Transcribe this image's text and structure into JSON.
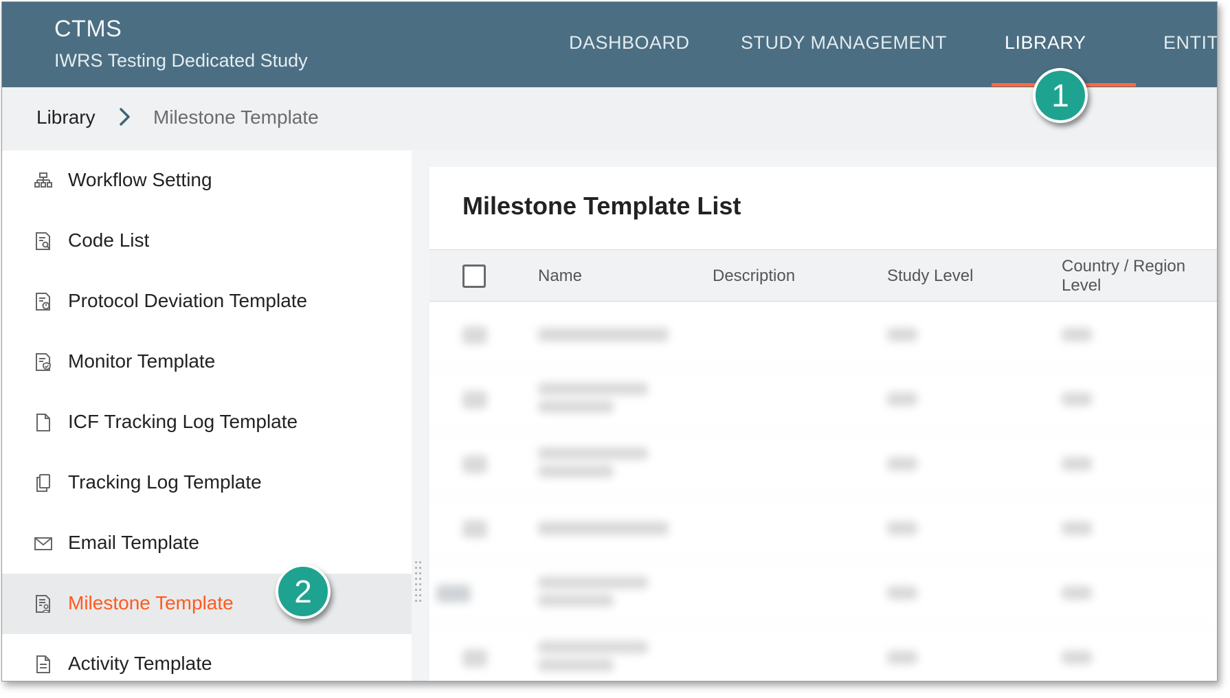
{
  "app": {
    "title": "CTMS",
    "study": "IWRS Testing Dedicated Study"
  },
  "nav": {
    "items": [
      {
        "label": "DASHBOARD"
      },
      {
        "label": "STUDY MANAGEMENT"
      },
      {
        "label": "LIBRARY",
        "active": true
      },
      {
        "label": "ENTIT"
      }
    ],
    "accent_color": "#ff6a3d"
  },
  "breadcrumb": {
    "root": "Library",
    "separator": ">",
    "current": "Milestone Template"
  },
  "sidebar": {
    "items": [
      {
        "label": "Workflow Setting",
        "icon": "workflow-icon"
      },
      {
        "label": "Code List",
        "icon": "document-search-icon"
      },
      {
        "label": "Protocol Deviation Template",
        "icon": "document-alert-icon"
      },
      {
        "label": "Monitor Template",
        "icon": "document-shield-icon"
      },
      {
        "label": "ICF Tracking Log Template",
        "icon": "document-icon"
      },
      {
        "label": "Tracking Log Template",
        "icon": "documents-stack-icon"
      },
      {
        "label": "Email Template",
        "icon": "envelope-icon"
      },
      {
        "label": "Milestone Template",
        "icon": "document-user-icon",
        "active": true
      },
      {
        "label": "Activity Template",
        "icon": "document-lines-icon"
      }
    ],
    "active_color": "#ff5a1f"
  },
  "main": {
    "title": "Milestone Template List",
    "table": {
      "columns": [
        "Name",
        "Description",
        "Study Level",
        "Country / Region",
        "Level"
      ]
    }
  },
  "callouts": [
    {
      "number": "1"
    },
    {
      "number": "2"
    }
  ],
  "colors": {
    "header_bg": "#4b6e82",
    "badge": "#1fa391"
  }
}
